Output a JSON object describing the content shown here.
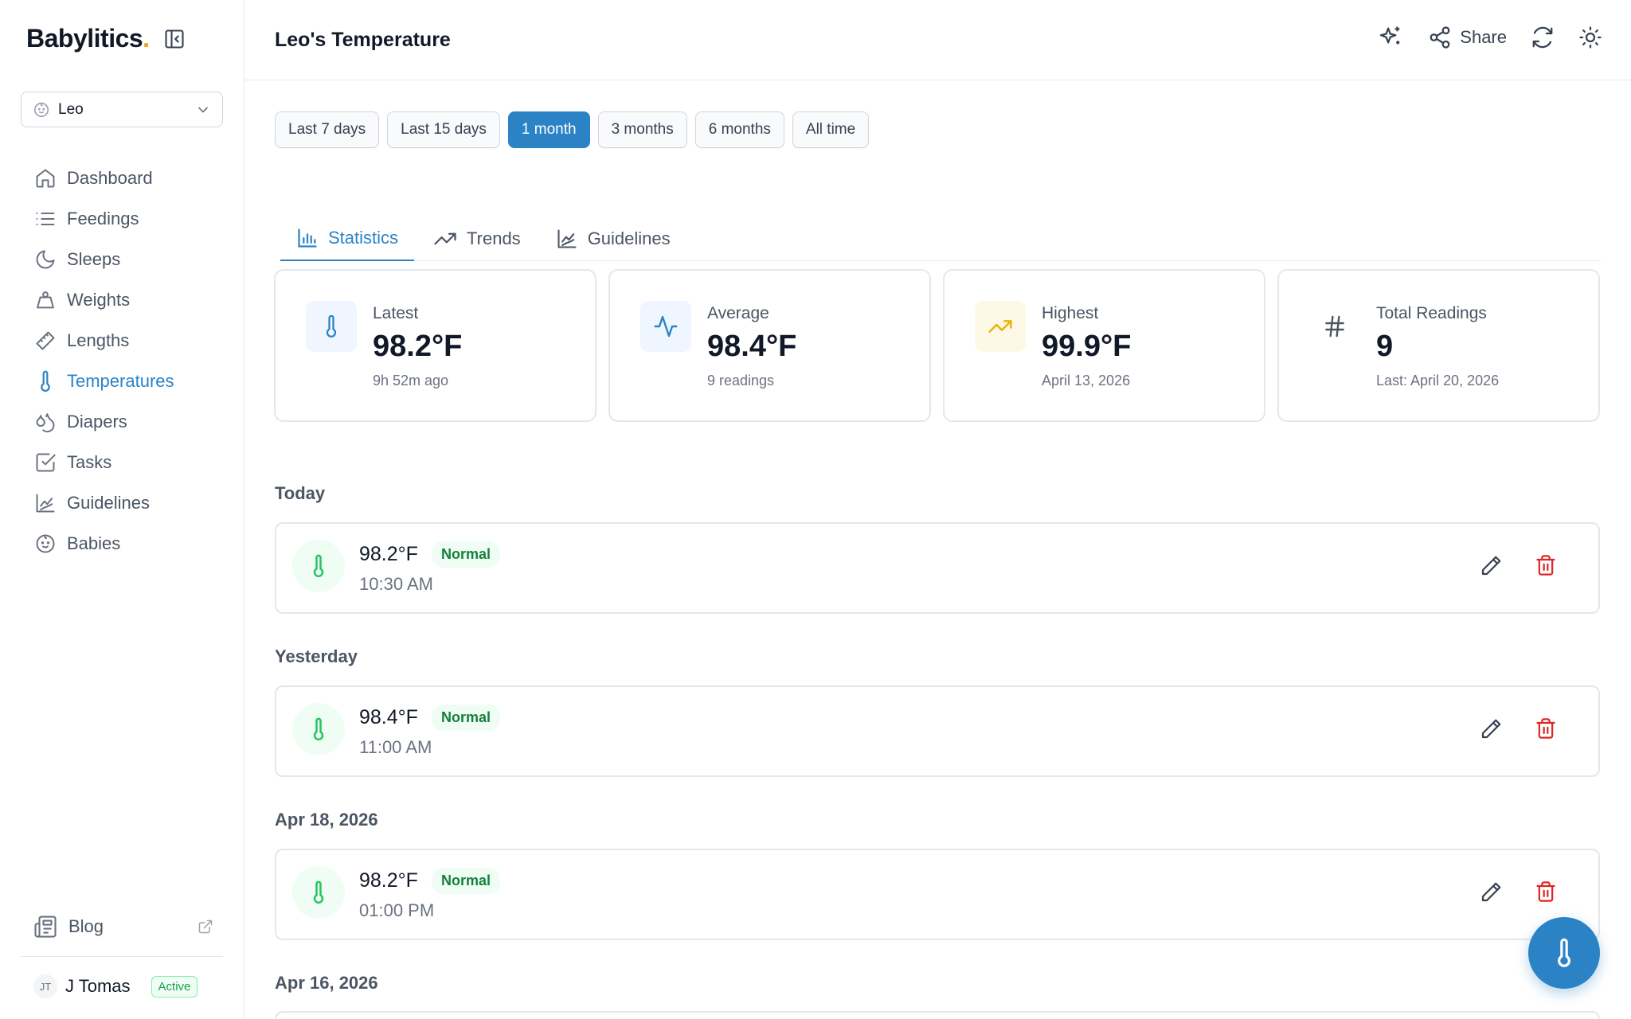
{
  "brand": {
    "name": "Babylitics",
    "dot": "."
  },
  "baby_select": {
    "value": "Leo"
  },
  "sidebar": {
    "items": [
      {
        "label": "Dashboard",
        "icon": "home-icon"
      },
      {
        "label": "Feedings",
        "icon": "list-icon"
      },
      {
        "label": "Sleeps",
        "icon": "moon-icon"
      },
      {
        "label": "Weights",
        "icon": "weight-icon"
      },
      {
        "label": "Lengths",
        "icon": "ruler-icon"
      },
      {
        "label": "Temperatures",
        "icon": "thermometer-icon",
        "active": true
      },
      {
        "label": "Diapers",
        "icon": "droplets-icon"
      },
      {
        "label": "Tasks",
        "icon": "checkbox-icon"
      },
      {
        "label": "Guidelines",
        "icon": "chart-icon"
      },
      {
        "label": "Babies",
        "icon": "baby-icon"
      }
    ],
    "blog_label": "Blog",
    "user": {
      "initials": "JT",
      "name": "J Tomas",
      "status": "Active"
    }
  },
  "header": {
    "title": "Leo's Temperature",
    "share_label": "Share"
  },
  "ranges": [
    {
      "label": "Last 7 days"
    },
    {
      "label": "Last 15 days"
    },
    {
      "label": "1 month",
      "active": true
    },
    {
      "label": "3 months"
    },
    {
      "label": "6 months"
    },
    {
      "label": "All time"
    }
  ],
  "tabs": [
    {
      "label": "Statistics",
      "active": true
    },
    {
      "label": "Trends"
    },
    {
      "label": "Guidelines"
    }
  ],
  "stats": [
    {
      "label": "Latest",
      "value": "98.2°F",
      "sub": "9h 52m ago",
      "icon": "thermometer-icon"
    },
    {
      "label": "Average",
      "value": "98.4°F",
      "sub": "9 readings",
      "icon": "activity-icon"
    },
    {
      "label": "Highest",
      "value": "99.9°F",
      "sub": "April 13, 2026",
      "icon": "trending-up-icon"
    },
    {
      "label": "Total Readings",
      "value": "9",
      "sub": "Last: April 20, 2026",
      "icon": "hash-icon"
    }
  ],
  "sections": [
    {
      "title": "Today",
      "entries": [
        {
          "temp": "98.2°F",
          "status": "Normal",
          "time": "10:30 AM"
        }
      ]
    },
    {
      "title": "Yesterday",
      "entries": [
        {
          "temp": "98.4°F",
          "status": "Normal",
          "time": "11:00 AM"
        }
      ]
    },
    {
      "title": "Apr 18, 2026",
      "entries": [
        {
          "temp": "98.2°F",
          "status": "Normal",
          "time": "01:00 PM"
        }
      ]
    },
    {
      "title": "Apr 16, 2026",
      "entries": []
    }
  ],
  "colors": {
    "accent": "#2b83c6",
    "normal": "#16a34a",
    "danger": "#dc2626"
  }
}
